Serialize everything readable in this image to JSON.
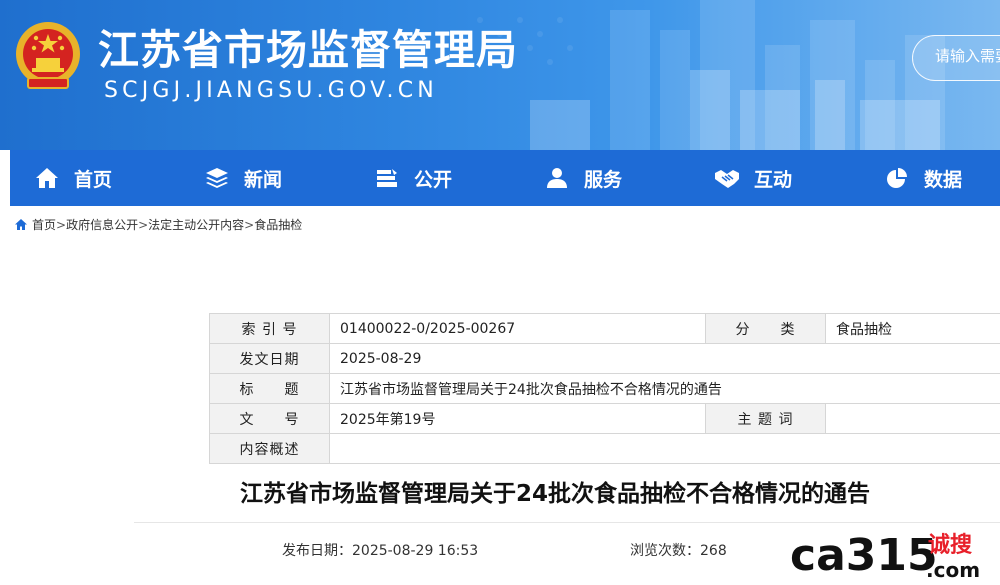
{
  "header": {
    "site_title": "江苏省市场监督管理局",
    "site_url": "SCJGJ.JIANGSU.GOV.CN",
    "search_placeholder": "请输入需要"
  },
  "nav": {
    "items": [
      {
        "label": "首页",
        "icon": "home-icon"
      },
      {
        "label": "新闻",
        "icon": "stack-icon"
      },
      {
        "label": "公开",
        "icon": "folder-icon"
      },
      {
        "label": "服务",
        "icon": "users-icon"
      },
      {
        "label": "互动",
        "icon": "handshake-icon"
      },
      {
        "label": "数据",
        "icon": "pie-chart-icon"
      }
    ]
  },
  "breadcrumb": {
    "items": [
      "首页",
      "政府信息公开",
      "法定主动公开内容",
      "食品抽检"
    ],
    "separator": ">"
  },
  "info_table": {
    "index_label": "索 引 号",
    "index_value": "01400022-0/2025-00267",
    "category_label": "分　　类",
    "category_value": "食品抽检",
    "date_label": "发文日期",
    "date_value": "2025-08-29",
    "title_label": "标　　题",
    "title_value": "江苏省市场监督管理局关于24批次食品抽检不合格情况的通告",
    "docno_label": "文　　号",
    "docno_value": "2025年第19号",
    "subject_label": "主 题 词",
    "subject_value": "",
    "summary_label": "内容概述",
    "summary_value": ""
  },
  "article": {
    "title": "江苏省市场监督管理局关于24批次食品抽检不合格情况的通告",
    "publish_label": "发布日期：",
    "publish_value": "2025-08-29 16:53",
    "views_label": "浏览次数：",
    "views_value": "268"
  },
  "watermark": {
    "brand": "ca315",
    "cn_text": "诚搜",
    "suffix": ".com"
  },
  "colors": {
    "nav_bg": "#1e6bd6",
    "banner_blue": "#2f86e0",
    "watermark_red": "#e8202a"
  }
}
